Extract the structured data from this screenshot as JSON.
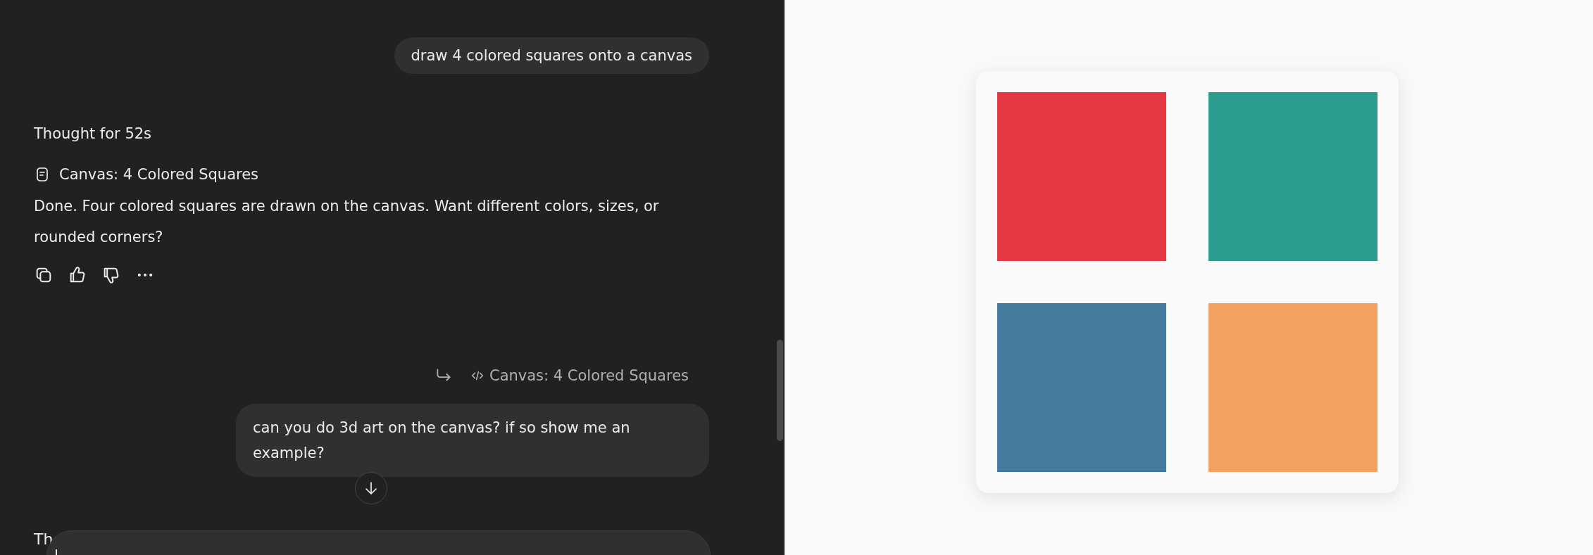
{
  "chat": {
    "messages": [
      {
        "kind": "user",
        "text": "draw 4 colored squares onto a canvas"
      },
      {
        "kind": "assistant",
        "thought": "Thought for 52s",
        "canvas_ref": "Canvas: 4 Colored Squares",
        "text": "Done. Four colored squares are drawn on the canvas. Want different colors, sizes, or rounded corners?"
      },
      {
        "kind": "user",
        "reference": "Canvas: 4 Colored Squares",
        "text": "can you do 3d art on the canvas? if so show me an example?"
      },
      {
        "kind": "partial",
        "text": "Th"
      }
    ]
  },
  "canvas": {
    "squares": [
      {
        "color": "#e63946"
      },
      {
        "color": "#2a9d8f"
      },
      {
        "color": "#457b9d"
      },
      {
        "color": "#f4a261"
      }
    ]
  }
}
